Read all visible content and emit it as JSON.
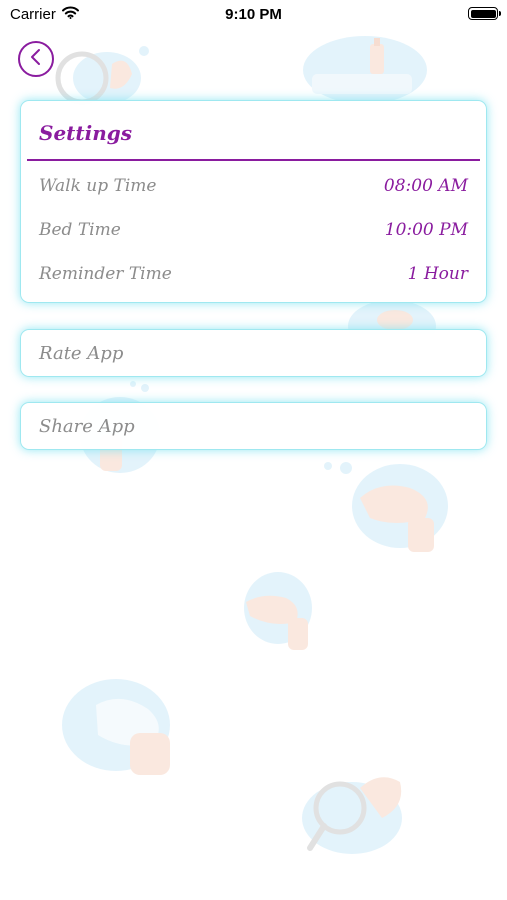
{
  "status_bar": {
    "carrier": "Carrier",
    "time": "9:10 PM"
  },
  "settings": {
    "title": "Settings",
    "rows": [
      {
        "label": "Walk up Time",
        "value": "08:00 AM"
      },
      {
        "label": "Bed Time",
        "value": "10:00 PM"
      },
      {
        "label": "Reminder Time",
        "value": "1 Hour"
      }
    ]
  },
  "actions": {
    "rate": "Rate App",
    "share": "Share App"
  },
  "colors": {
    "accent": "#8a1c9f",
    "card_glow": "#9fe8f0",
    "label_gray": "#8c8c8c",
    "illustration_blue": "#cdeaf8",
    "illustration_skin": "#f6d6c6"
  },
  "icons": {
    "back": "chevron-left-icon",
    "wifi": "wifi-icon",
    "battery": "battery-icon"
  }
}
